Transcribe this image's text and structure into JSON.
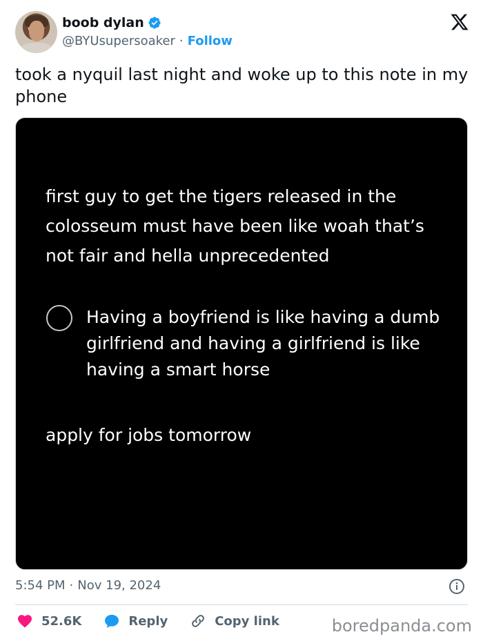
{
  "author": {
    "display_name": "boob dylan",
    "handle": "@BYUsupersoaker",
    "separator": "·",
    "follow_label": "Follow"
  },
  "tweet": {
    "text": "took a nyquil last night and woke up to this note in my phone"
  },
  "note": {
    "line1": "first guy to get the tigers released in the colosseum must have been like woah that’s not fair and hella unprecedented",
    "checklist_item": "Having a boyfriend is like having a dumb girlfriend and having a girlfriend is like having a smart horse",
    "line3": "apply for jobs tomorrow"
  },
  "meta": {
    "time": "5:54 PM",
    "separator": "·",
    "date": "Nov 19, 2024"
  },
  "actions": {
    "likes": "52.6K",
    "reply_label": "Reply",
    "copy_label": "Copy link"
  },
  "watermark": "boredpanda.com",
  "colors": {
    "accent": "#1d9bf0",
    "like": "#f91880",
    "muted": "#536471"
  },
  "icons": [
    "verified-badge-icon",
    "x-logo-icon",
    "info-icon",
    "heart-icon",
    "reply-bubble-icon",
    "link-icon",
    "checkbox-circle-icon"
  ]
}
